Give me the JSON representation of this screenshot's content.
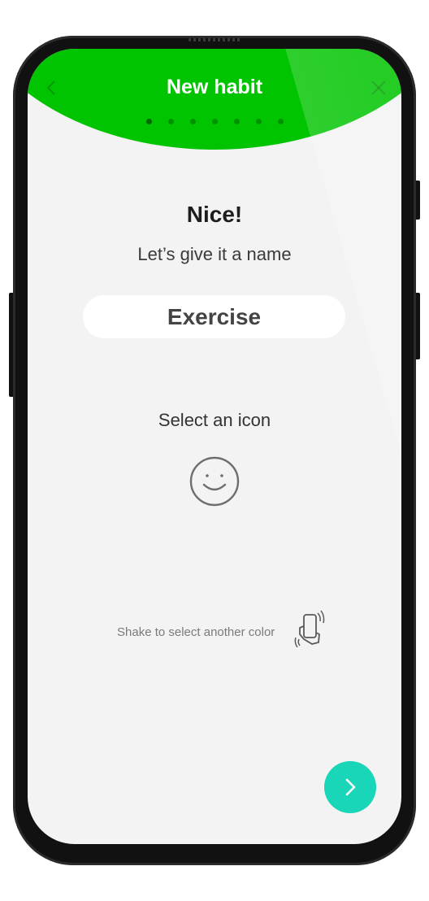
{
  "header": {
    "title": "New habit",
    "back_icon": "chevron-left-icon",
    "close_icon": "close-icon",
    "accent_color": "#00c400",
    "steps_total": 7,
    "step_current": 1
  },
  "main": {
    "heading": "Nice!",
    "subheading": "Let’s give it a name",
    "name_value": "Exercise",
    "icon_section_label": "Select an icon",
    "selected_icon": "smiley-face-icon",
    "shake_hint": "Shake to select another color",
    "shake_icon": "phone-shake-icon"
  },
  "footer": {
    "next_icon": "chevron-right-icon",
    "next_button_color": "#1ad6b8"
  }
}
